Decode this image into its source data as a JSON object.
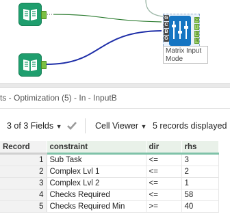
{
  "canvas": {
    "matrix_tool_label": "Matrix Input Mode",
    "anchors": [
      "G",
      "C",
      "B",
      "G"
    ],
    "outputs": [
      "O",
      "I",
      "S",
      "R"
    ]
  },
  "results": {
    "title": "ts - Optimization (5) - In - InputB",
    "fields_label": "3 of 3 Fields",
    "viewer_label": "Cell Viewer",
    "records_label": "5 records displayed",
    "columns": [
      "Record",
      "constraint",
      "dir",
      "rhs"
    ],
    "rows": [
      [
        "1",
        "Sub Task",
        "<=",
        "3"
      ],
      [
        "2",
        "Complex Lvl 1",
        "<=",
        "2"
      ],
      [
        "3",
        "Complex Lvl 2",
        "<=",
        "1"
      ],
      [
        "4",
        "Checks Required",
        "<=",
        "58"
      ],
      [
        "5",
        "Checks Required Min",
        ">=",
        "40"
      ]
    ]
  },
  "colors": {
    "input_tool": "#1f9e6e",
    "matrix_tool": "#1575c2",
    "connector": "#1f2fa8"
  }
}
